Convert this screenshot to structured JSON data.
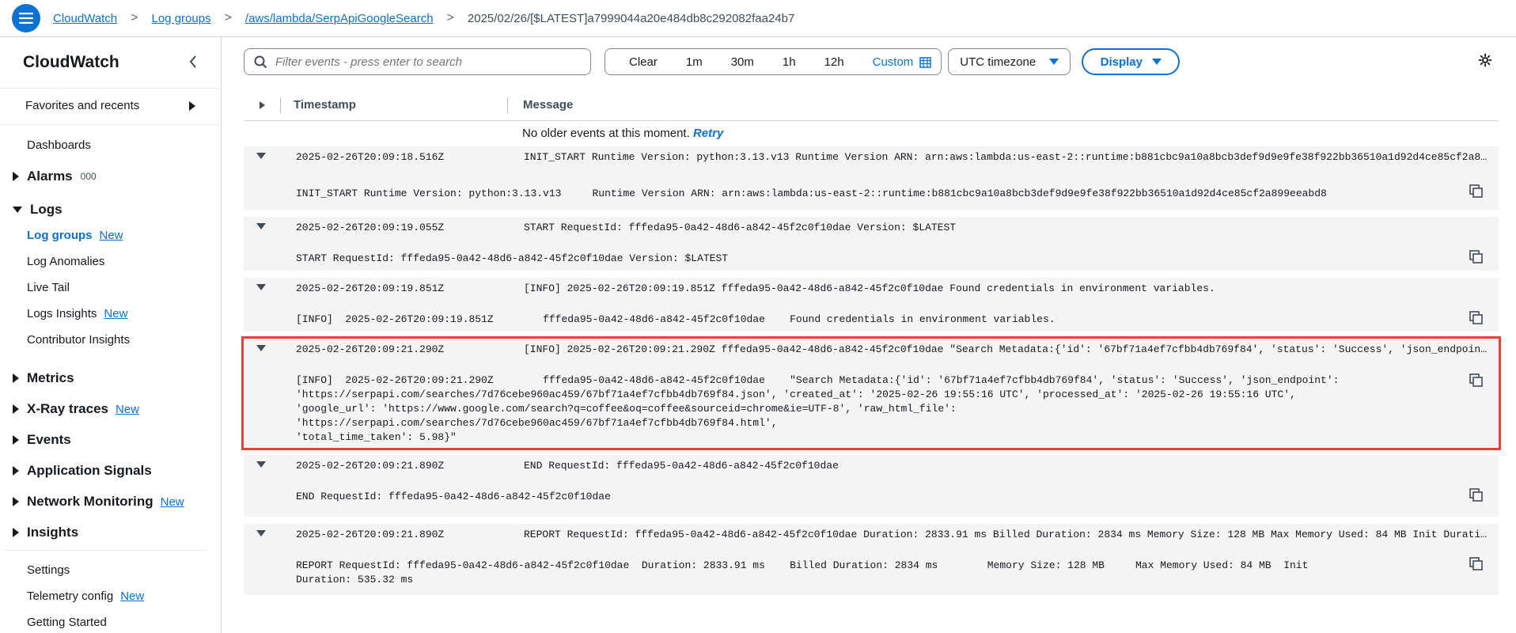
{
  "breadcrumbs": {
    "items": [
      "CloudWatch",
      "Log groups",
      "/aws/lambda/SerpApiGoogleSearch"
    ],
    "current": "2025/02/26/[$LATEST]a7999044a20e484db8c292082faa24b7",
    "separator": ">"
  },
  "sidebar": {
    "title": "CloudWatch",
    "favorites": "Favorites and recents",
    "dashboards": "Dashboards",
    "alarms": {
      "label": "Alarms",
      "alarm_count": "0",
      "ok_count": "0",
      "insufficient_count": "0"
    },
    "logs": {
      "label": "Logs",
      "items": [
        {
          "label": "Log groups",
          "new": "New"
        },
        {
          "label": "Log Anomalies"
        },
        {
          "label": "Live Tail"
        },
        {
          "label": "Logs Insights",
          "new": "New"
        },
        {
          "label": "Contributor Insights"
        }
      ]
    },
    "sections": [
      {
        "label": "Metrics"
      },
      {
        "label": "X-Ray traces",
        "new": "New"
      },
      {
        "label": "Events"
      },
      {
        "label": "Application Signals"
      },
      {
        "label": "Network Monitoring",
        "new": "New"
      },
      {
        "label": "Insights"
      }
    ],
    "footer": [
      {
        "label": "Settings"
      },
      {
        "label": "Telemetry config",
        "new": "New"
      },
      {
        "label": "Getting Started"
      }
    ]
  },
  "toolbar": {
    "search_placeholder": "Filter events - press enter to search",
    "time_options": [
      "Clear",
      "1m",
      "30m",
      "1h",
      "12h",
      "Custom"
    ],
    "timezone": "UTC timezone",
    "display": "Display"
  },
  "table": {
    "col_timestamp": "Timestamp",
    "col_message": "Message",
    "no_older": "No older events at this moment.",
    "retry": "Retry"
  },
  "events": [
    {
      "timestamp": "2025-02-26T20:09:18.516Z",
      "message": "INIT_START Runtime Version: python:3.13.v13 Runtime Version ARN: arn:aws:lambda:us-east-2::runtime:b881cbc9a10a8bcb3def9d9e9fe38f922bb36510a1d92d4ce85cf2a899eeabd8",
      "detail": "INIT_START Runtime Version: python:3.13.v13\tRuntime Version ARN: arn:aws:lambda:us-east-2::runtime:b881cbc9a10a8bcb3def9d9e9fe38f922bb36510a1d92d4ce85cf2a899eeabd8"
    },
    {
      "timestamp": "2025-02-26T20:09:19.055Z",
      "message": "START RequestId: fffeda95-0a42-48d6-a842-45f2c0f10dae Version: $LATEST",
      "detail": "START RequestId: fffeda95-0a42-48d6-a842-45f2c0f10dae Version: $LATEST"
    },
    {
      "timestamp": "2025-02-26T20:09:19.851Z",
      "message": "[INFO] 2025-02-26T20:09:19.851Z fffeda95-0a42-48d6-a842-45f2c0f10dae Found credentials in environment variables.",
      "detail": "[INFO]\t2025-02-26T20:09:19.851Z\tfffeda95-0a42-48d6-a842-45f2c0f10dae\tFound credentials in environment variables."
    },
    {
      "timestamp": "2025-02-26T20:09:21.290Z",
      "message": "[INFO] 2025-02-26T20:09:21.290Z fffeda95-0a42-48d6-a842-45f2c0f10dae \"Search Metadata:{'id': '67bf71a4ef7cfbb4db769f84', 'status': 'Success', 'json_endpoint': 'https://serpapi.com/searches/7d76cebe960ac459/67bf71a4ef7cfbb4db769f84.json'",
      "detail": "[INFO]\t2025-02-26T20:09:21.290Z\tfffeda95-0a42-48d6-a842-45f2c0f10dae\t\"Search Metadata:{'id': '67bf71a4ef7cfbb4db769f84', 'status': 'Success', 'json_endpoint':\n'https://serpapi.com/searches/7d76cebe960ac459/67bf71a4ef7cfbb4db769f84.json', 'created_at': '2025-02-26 19:55:16 UTC', 'processed_at': '2025-02-26 19:55:16 UTC',\n'google_url': 'https://www.google.com/search?q=coffee&oq=coffee&sourceid=chrome&ie=UTF-8', 'raw_html_file': 'https://serpapi.com/searches/7d76cebe960ac459/67bf71a4ef7cfbb4db769f84.html',\n'total_time_taken': 5.98}\""
    },
    {
      "timestamp": "2025-02-26T20:09:21.890Z",
      "message": "END RequestId: fffeda95-0a42-48d6-a842-45f2c0f10dae",
      "detail": "END RequestId: fffeda95-0a42-48d6-a842-45f2c0f10dae"
    },
    {
      "timestamp": "2025-02-26T20:09:21.890Z",
      "message": "REPORT RequestId: fffeda95-0a42-48d6-a842-45f2c0f10dae Duration: 2833.91 ms Billed Duration: 2834 ms Memory Size: 128 MB Max Memory Used: 84 MB Init Duration: 535.32 ms",
      "detail": "REPORT RequestId: fffeda95-0a42-48d6-a842-45f2c0f10dae\tDuration: 2833.91 ms\tBilled Duration: 2834 ms\tMemory Size: 128 MB\tMax Memory Used: 84 MB\tInit\nDuration: 535.32 ms"
    }
  ],
  "colors": {
    "accent": "#0972d3",
    "highlight": "#e8413b",
    "row_bg": "#f4f4f4"
  },
  "icons": {
    "menu": "hamburger-icon",
    "search": "search-icon",
    "calendar": "calendar-icon",
    "copy": "copy-icon",
    "settings": "gear-icon"
  }
}
